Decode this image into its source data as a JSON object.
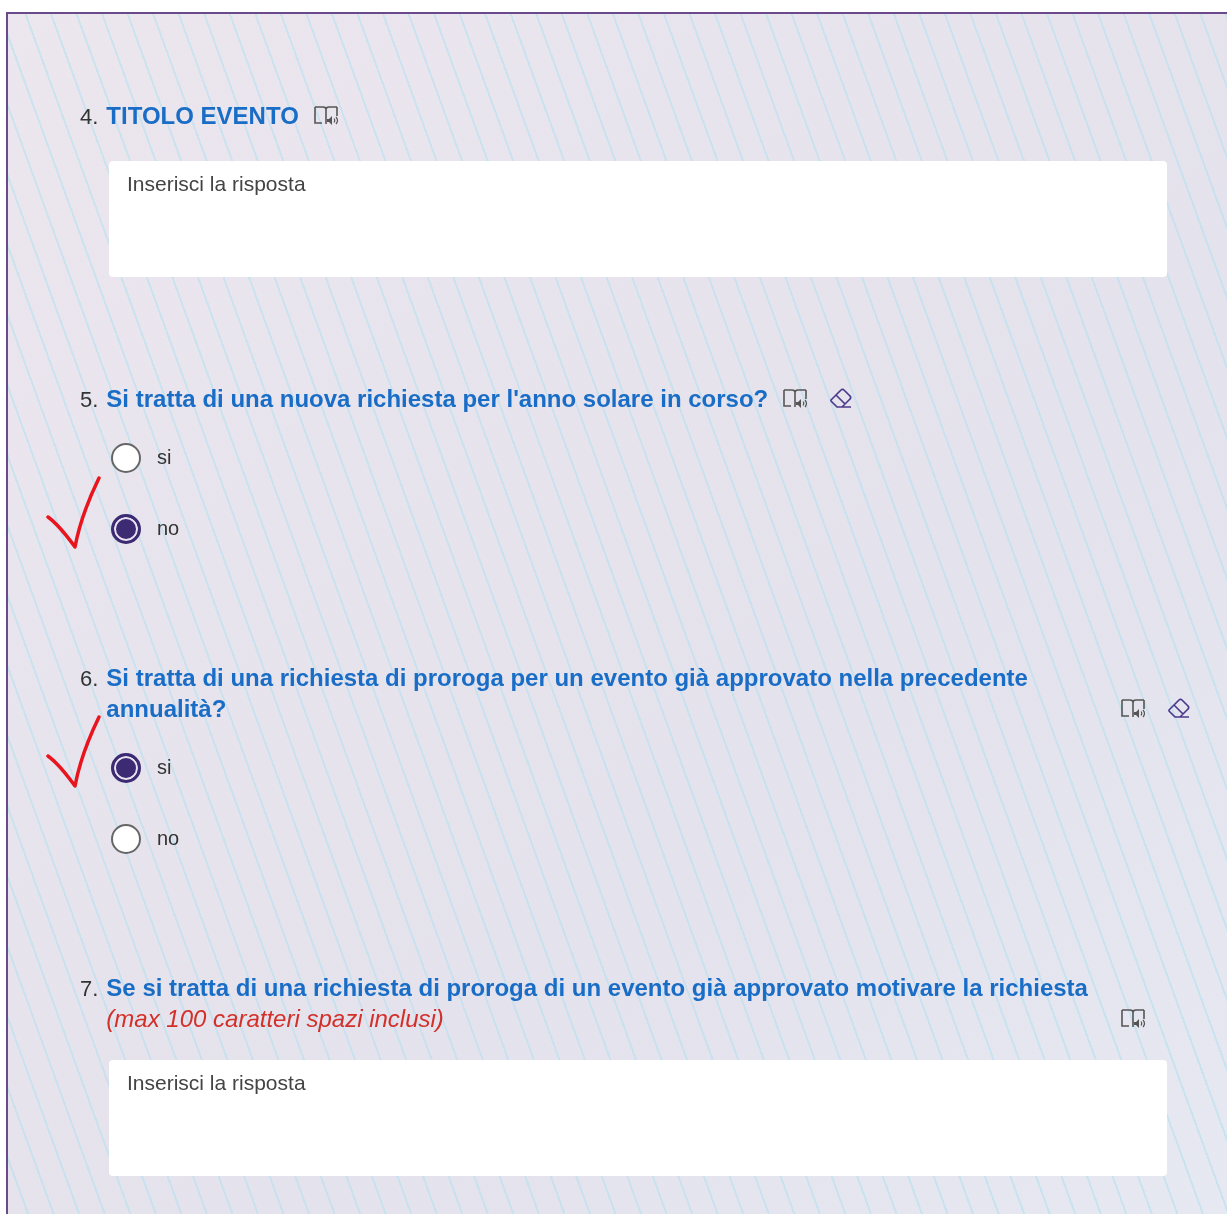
{
  "questions": [
    {
      "number": "4.",
      "title": "TITOLO EVENTO",
      "kind": "text",
      "reader": true,
      "eraser": false,
      "placeholder": "Inserisci la risposta"
    },
    {
      "number": "5.",
      "title": "Si tratta di una nuova richiesta per l'anno solare in corso?",
      "kind": "choice",
      "reader": true,
      "eraser": true,
      "options": [
        {
          "label": "si",
          "selected": false,
          "ticked": false
        },
        {
          "label": "no",
          "selected": true,
          "ticked": true
        }
      ]
    },
    {
      "number": "6.",
      "title": "Si tratta di una richiesta di proroga per un evento già approvato nella precedente annualità?",
      "kind": "choice",
      "reader": true,
      "eraser": true,
      "options": [
        {
          "label": "si",
          "selected": true,
          "ticked": true
        },
        {
          "label": "no",
          "selected": false,
          "ticked": false
        }
      ]
    },
    {
      "number": "7.",
      "title": "Se si tratta di una richiesta di proroga di un evento già approvato motivare la richiesta *(max 100 caratteri spazi inclusi)*",
      "kind": "text",
      "reader": true,
      "eraser": false,
      "placeholder": "Inserisci la risposta"
    }
  ]
}
